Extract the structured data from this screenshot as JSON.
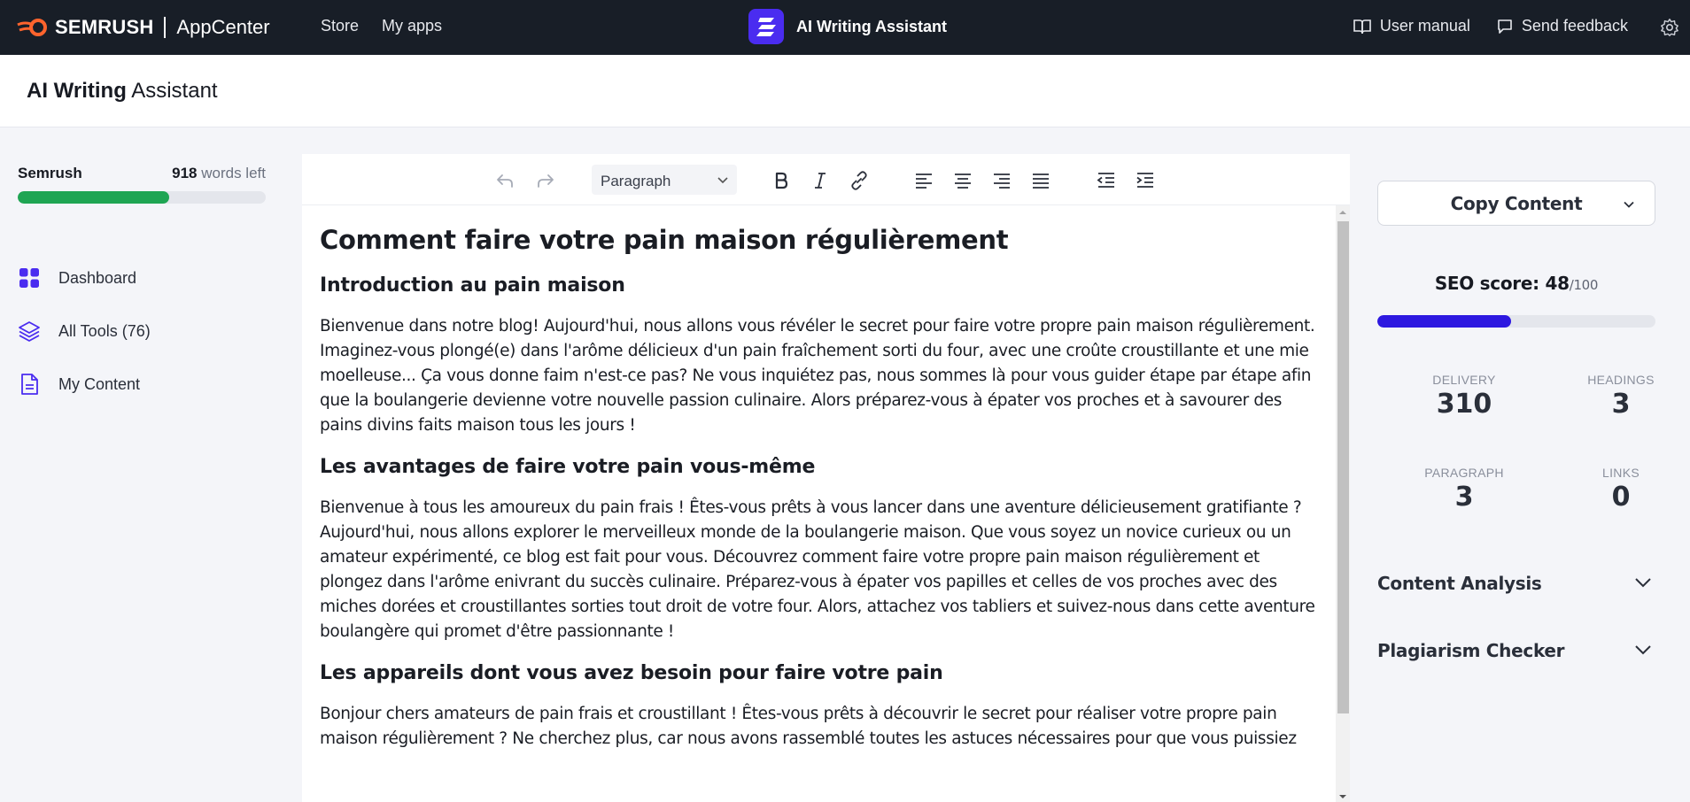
{
  "topbar": {
    "brand_name": "SEMRUSH",
    "brand_app": "AppCenter",
    "nav": [
      {
        "label": "Store"
      },
      {
        "label": "My apps"
      }
    ],
    "app_title": "AI Writing Assistant",
    "user_manual": "User manual",
    "send_feedback": "Send feedback",
    "brand_color": "#ff642d",
    "app_icon_color": "#4a2cf0"
  },
  "page": {
    "title_bold": "AI Writing",
    "title_rest": " Assistant"
  },
  "sidebar": {
    "plan_name": "Semrush",
    "words_count": "918",
    "words_left_label": " words left",
    "words_progress": 0.61,
    "items": [
      {
        "label": "Dashboard",
        "icon": "grid-icon"
      },
      {
        "label": "All Tools (76)",
        "icon": "layers-icon"
      },
      {
        "label": "My Content",
        "icon": "document-icon"
      }
    ]
  },
  "toolbar": {
    "block_format": "Paragraph"
  },
  "document": {
    "title": "Comment faire votre pain maison régulièrement",
    "sections": [
      {
        "heading": "Introduction au pain maison",
        "body": "Bienvenue dans notre blog! Aujourd'hui, nous allons vous révéler le secret pour faire votre propre pain maison régulièrement. Imaginez-vous plongé(e) dans l'arôme délicieux d'un pain fraîchement sorti du four, avec une croûte croustillante et une mie moelleuse... Ça vous donne faim n'est-ce pas? Ne vous inquiétez pas, nous sommes là pour vous guider étape par étape afin que la boulangerie devienne votre nouvelle passion culinaire. Alors préparez-vous à épater vos proches et à savourer des pains divins faits maison tous les jours !"
      },
      {
        "heading": "Les avantages de faire votre pain vous-même",
        "body": "Bienvenue à tous les amoureux du pain frais ! Êtes-vous prêts à vous lancer dans une aventure délicieusement gratifiante ? Aujourd'hui, nous allons explorer le merveilleux monde de la boulangerie maison. Que vous soyez un novice curieux ou un amateur expérimenté, ce blog est fait pour vous. Découvrez comment faire votre propre pain maison régulièrement et plongez dans l'arôme enivrant du succès culinaire. Préparez-vous à épater vos papilles et celles de vos proches avec des miches dorées et croustillantes sorties tout droit de votre four. Alors, attachez vos tabliers et suivez-nous dans cette aventure boulangère qui promet d'être passionnante !"
      },
      {
        "heading": "Les appareils dont vous avez besoin pour faire votre pain",
        "body": "Bonjour chers amateurs de pain frais et croustillant ! Êtes-vous prêts à découvrir le secret pour réaliser votre propre pain maison régulièrement ? Ne cherchez plus, car nous avons rassemblé toutes les astuces nécessaires pour que vous puissiez"
      }
    ]
  },
  "right_panel": {
    "copy_label": "Copy Content",
    "seo_label": "SEO score: ",
    "seo_value": "48",
    "seo_max": "/100",
    "seo_progress": 0.48,
    "seo_color": "#2d18e0",
    "stats": {
      "delivery_label": "DELIVERY",
      "delivery_value": "310",
      "headings_label": "HEADINGS",
      "headings_value": "3",
      "paragraph_label": "PARAGRAPH",
      "paragraph_value": "3",
      "links_label": "LINKS",
      "links_value": "0"
    },
    "content_analysis": "Content Analysis",
    "plagiarism_checker": "Plagiarism Checker"
  }
}
